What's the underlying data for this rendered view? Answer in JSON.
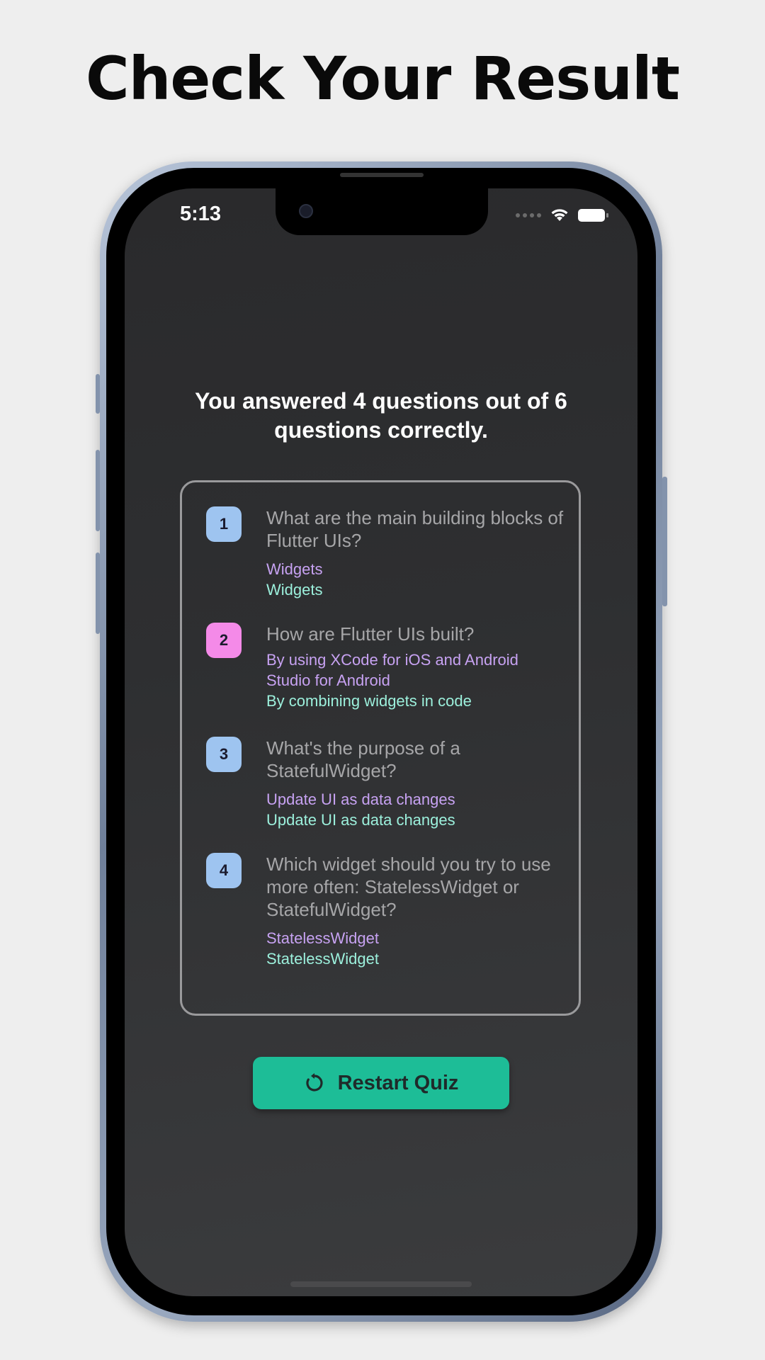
{
  "headline": "Check Your Result",
  "status_bar": {
    "time": "5:13",
    "icons": [
      "cellular-dots-icon",
      "wifi-icon",
      "battery-icon"
    ]
  },
  "summary": "You answered 4 questions out of 6 questions correctly.",
  "results": [
    {
      "index": "1",
      "question": "What are the main building blocks of Flutter UIs?",
      "user_answer": "Widgets",
      "correct_answer": "Widgets",
      "is_correct": true
    },
    {
      "index": "2",
      "question": "How are Flutter UIs built?",
      "user_answer": "By using XCode for iOS and Android Studio for Android",
      "correct_answer": "By combining widgets in code",
      "is_correct": false
    },
    {
      "index": "3",
      "question": "What's the purpose of a StatefulWidget?",
      "user_answer": "Update UI as data changes",
      "correct_answer": "Update UI as data changes",
      "is_correct": true
    },
    {
      "index": "4",
      "question": "Which widget should you try to use more often: StatelessWidget or StatefulWidget?",
      "user_answer": "StatelessWidget",
      "correct_answer": "StatelessWidget",
      "is_correct": true
    }
  ],
  "restart_button": {
    "label": "Restart Quiz",
    "icon": "restart-icon"
  },
  "colors": {
    "correct_badge": "#9ec4f0",
    "wrong_badge": "#f48ae8",
    "accent_button": "#1dbd97",
    "user_answer": "#c7a2f2",
    "correct_answer": "#9cf0dc"
  }
}
